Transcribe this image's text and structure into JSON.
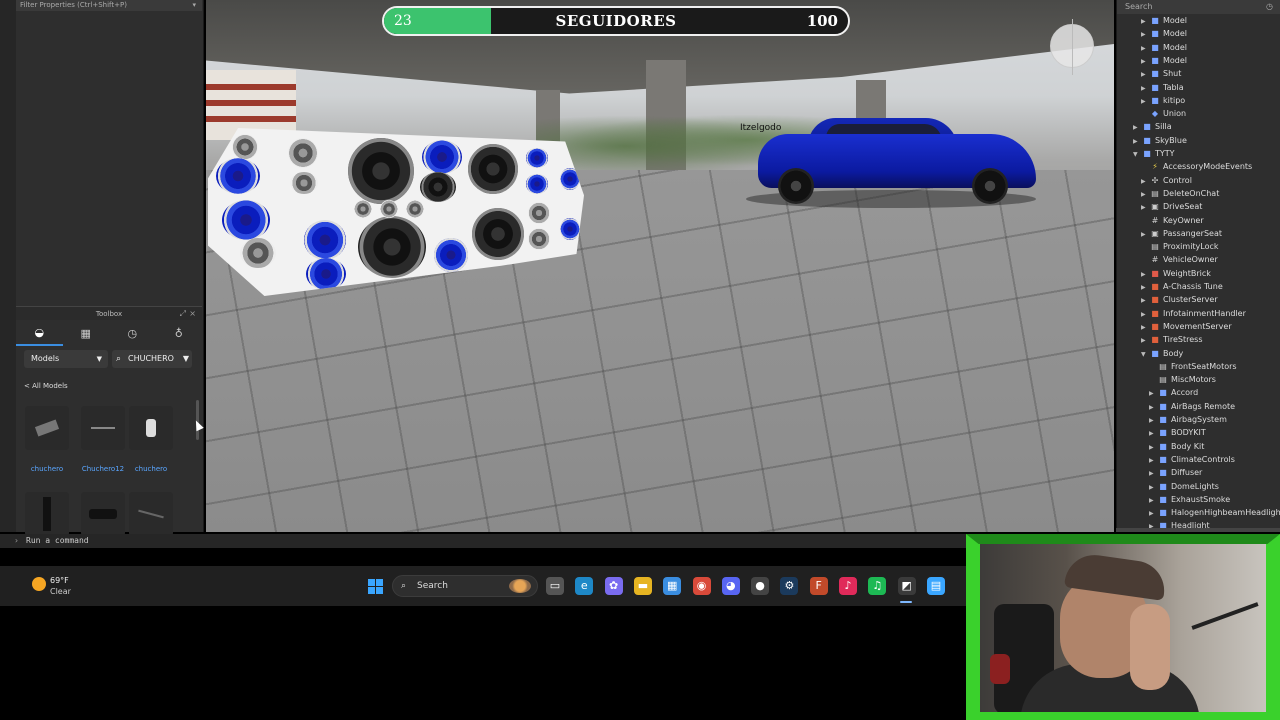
{
  "left_panel": {
    "filter_label": "Filter Properties (Ctrl+Shift+P)",
    "toolbox_title": "Toolbox",
    "models_dropdown": "Models",
    "search_value": "CHUCHERO",
    "back_link": "< All Models",
    "items": [
      {
        "label": "chuchero"
      },
      {
        "label": "Chuchero12"
      },
      {
        "label": "chuchero"
      }
    ]
  },
  "viewport": {
    "player_name": "Itzelgodo"
  },
  "followers": {
    "current": "23",
    "title": "SEGUIDORES",
    "goal": "100",
    "progress": 0.23,
    "fill_color": "#3cc36e"
  },
  "explorer": {
    "search_placeholder": "Search",
    "rows": [
      {
        "label": "Model",
        "icon": "model-icon",
        "glyph": "■",
        "color": "#7aa3ff",
        "level": 2,
        "arrow": "▶"
      },
      {
        "label": "Model",
        "icon": "model-icon",
        "glyph": "■",
        "color": "#7aa3ff",
        "level": 2,
        "arrow": "▶"
      },
      {
        "label": "Model",
        "icon": "model-icon",
        "glyph": "■",
        "color": "#7aa3ff",
        "level": 2,
        "arrow": "▶"
      },
      {
        "label": "Model",
        "icon": "model-icon",
        "glyph": "■",
        "color": "#7aa3ff",
        "level": 2,
        "arrow": "▶"
      },
      {
        "label": "Shut",
        "icon": "model-icon",
        "glyph": "■",
        "color": "#7aa3ff",
        "level": 2,
        "arrow": "▶"
      },
      {
        "label": "Tabla",
        "icon": "model-icon",
        "glyph": "■",
        "color": "#7aa3ff",
        "level": 2,
        "arrow": "▶"
      },
      {
        "label": "kitipo",
        "icon": "model-icon",
        "glyph": "■",
        "color": "#7aa3ff",
        "level": 2,
        "arrow": "▶"
      },
      {
        "label": "Union",
        "icon": "union-icon",
        "glyph": "◆",
        "color": "#7aa3ff",
        "level": 2,
        "arrow": ""
      },
      {
        "label": "Silla",
        "icon": "model-icon",
        "glyph": "■",
        "color": "#7aa3ff",
        "level": 1,
        "arrow": "▶"
      },
      {
        "label": "SkyBlue",
        "icon": "model-icon",
        "glyph": "■",
        "color": "#7aa3ff",
        "level": 1,
        "arrow": "▶"
      },
      {
        "label": "TYTY",
        "icon": "model-icon",
        "glyph": "■",
        "color": "#7aa3ff",
        "level": 1,
        "arrow": "▼"
      },
      {
        "label": "AccessoryModeEvents",
        "icon": "remote-event-icon",
        "glyph": "⚡",
        "color": "#e0c84a",
        "level": 2,
        "arrow": ""
      },
      {
        "label": "Control",
        "icon": "script-icon",
        "glyph": "✣",
        "color": "#cccccc",
        "level": 2,
        "arrow": "▶"
      },
      {
        "label": "DeleteOnChat",
        "icon": "script-icon",
        "glyph": "▤",
        "color": "#cccccc",
        "level": 2,
        "arrow": "▶"
      },
      {
        "label": "DriveSeat",
        "icon": "seat-icon",
        "glyph": "▣",
        "color": "#cccccc",
        "level": 2,
        "arrow": "▶"
      },
      {
        "label": "KeyOwner",
        "icon": "value-icon",
        "glyph": "#",
        "color": "#cccccc",
        "level": 2,
        "arrow": ""
      },
      {
        "label": "PassangerSeat",
        "icon": "seat-icon",
        "glyph": "▣",
        "color": "#cccccc",
        "level": 2,
        "arrow": "▶"
      },
      {
        "label": "ProximityLock",
        "icon": "script-icon",
        "glyph": "▤",
        "color": "#cccccc",
        "level": 2,
        "arrow": ""
      },
      {
        "label": "VehicleOwner",
        "icon": "value-icon",
        "glyph": "#",
        "color": "#cccccc",
        "level": 2,
        "arrow": ""
      },
      {
        "label": "WeightBrick",
        "icon": "part-icon",
        "glyph": "■",
        "color": "#e05a4a",
        "level": 2,
        "arrow": "▶"
      },
      {
        "label": "A-Chassis Tune",
        "icon": "module-icon",
        "glyph": "■",
        "color": "#e0603c",
        "level": 2,
        "arrow": "▶"
      },
      {
        "label": "ClusterServer",
        "icon": "script-icon",
        "glyph": "■",
        "color": "#e0603c",
        "level": 2,
        "arrow": "▶"
      },
      {
        "label": "InfotainmentHandler",
        "icon": "script-icon",
        "glyph": "■",
        "color": "#e0603c",
        "level": 2,
        "arrow": "▶"
      },
      {
        "label": "MovementServer",
        "icon": "script-icon",
        "glyph": "■",
        "color": "#e0603c",
        "level": 2,
        "arrow": "▶"
      },
      {
        "label": "TireStress",
        "icon": "script-icon",
        "glyph": "■",
        "color": "#e0603c",
        "level": 2,
        "arrow": "▶"
      },
      {
        "label": "Body",
        "icon": "model-icon",
        "glyph": "■",
        "color": "#7aa3ff",
        "level": 2,
        "arrow": "▼"
      },
      {
        "label": "FrontSeatMotors",
        "icon": "folder-icon",
        "glyph": "▤",
        "color": "#cccccc",
        "level": 3,
        "arrow": ""
      },
      {
        "label": "MiscMotors",
        "icon": "folder-icon",
        "glyph": "▤",
        "color": "#cccccc",
        "level": 3,
        "arrow": ""
      },
      {
        "label": "Accord",
        "icon": "model-icon",
        "glyph": "■",
        "color": "#7aa3ff",
        "level": 3,
        "arrow": "▶"
      },
      {
        "label": "AirBags Remote",
        "icon": "model-icon",
        "glyph": "■",
        "color": "#7aa3ff",
        "level": 3,
        "arrow": "▶"
      },
      {
        "label": "AirbagSystem",
        "icon": "model-icon",
        "glyph": "■",
        "color": "#7aa3ff",
        "level": 3,
        "arrow": "▶"
      },
      {
        "label": "BODYKIT",
        "icon": "model-icon",
        "glyph": "■",
        "color": "#7aa3ff",
        "level": 3,
        "arrow": "▶"
      },
      {
        "label": "Body Kit",
        "icon": "model-icon",
        "glyph": "■",
        "color": "#7aa3ff",
        "level": 3,
        "arrow": "▶"
      },
      {
        "label": "ClimateControls",
        "icon": "model-icon",
        "glyph": "■",
        "color": "#7aa3ff",
        "level": 3,
        "arrow": "▶"
      },
      {
        "label": "Diffuser",
        "icon": "model-icon",
        "glyph": "■",
        "color": "#7aa3ff",
        "level": 3,
        "arrow": "▶"
      },
      {
        "label": "DomeLights",
        "icon": "model-icon",
        "glyph": "■",
        "color": "#7aa3ff",
        "level": 3,
        "arrow": "▶"
      },
      {
        "label": "ExhaustSmoke",
        "icon": "model-icon",
        "glyph": "■",
        "color": "#7aa3ff",
        "level": 3,
        "arrow": "▶"
      },
      {
        "label": "HalogenHighbeamHeadlights",
        "icon": "model-icon",
        "glyph": "■",
        "color": "#7aa3ff",
        "level": 3,
        "arrow": "▶"
      },
      {
        "label": "Headlight",
        "icon": "model-icon",
        "glyph": "■",
        "color": "#7aa3ff",
        "level": 3,
        "arrow": "▶"
      }
    ]
  },
  "command_bar": {
    "placeholder": "Run a command"
  },
  "taskbar": {
    "temperature": "69°F",
    "condition": "Clear",
    "search_label": "Search",
    "apps": [
      {
        "name": "task-view-icon",
        "glyph": "▭",
        "color": "#555555"
      },
      {
        "name": "edge-icon",
        "glyph": "e",
        "color": "#1e88c7"
      },
      {
        "name": "copilot-icon",
        "glyph": "✿",
        "color": "#7a6cf0"
      },
      {
        "name": "file-explorer-icon",
        "glyph": "▬",
        "color": "#e6b422"
      },
      {
        "name": "store-icon",
        "glyph": "▦",
        "color": "#3a8de0"
      },
      {
        "name": "chrome-icon",
        "glyph": "◉",
        "color": "#d94a3a"
      },
      {
        "name": "discord-icon",
        "glyph": "◕",
        "color": "#5865f2"
      },
      {
        "name": "obs-icon",
        "glyph": "●",
        "color": "#444444"
      },
      {
        "name": "steam-icon",
        "glyph": "⚙",
        "color": "#1b3a5c"
      },
      {
        "name": "tf-icon",
        "glyph": "F",
        "color": "#c24a2a"
      },
      {
        "name": "tiktok-icon",
        "glyph": "♪",
        "color": "#e02a5a"
      },
      {
        "name": "spotify-icon",
        "glyph": "♫",
        "color": "#1db954"
      },
      {
        "name": "roblox-studio-icon",
        "glyph": "◩",
        "color": "#3a3a3a"
      },
      {
        "name": "notepad-icon",
        "glyph": "▤",
        "color": "#3aa6ff"
      }
    ]
  }
}
